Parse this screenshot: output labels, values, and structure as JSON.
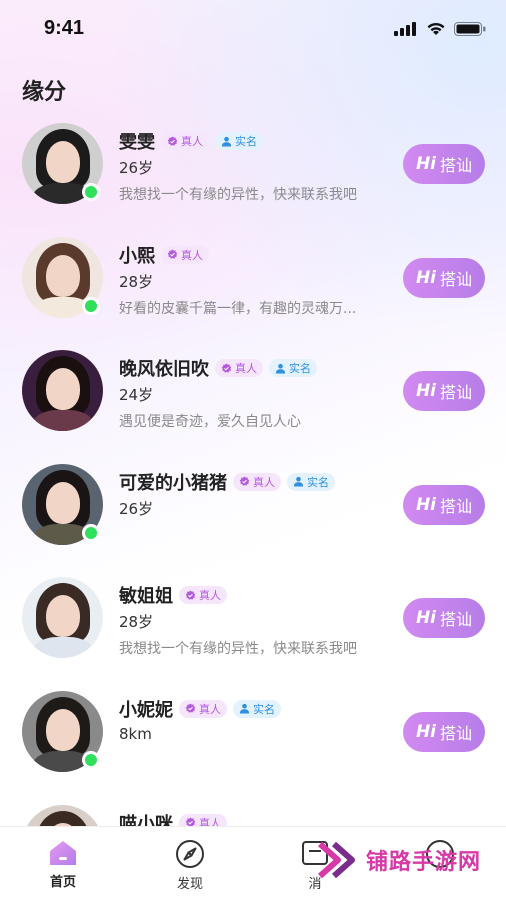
{
  "status_bar": {
    "time": "9:41"
  },
  "header": {
    "title": "缘分"
  },
  "tags": {
    "real": "真人",
    "verified": "实名"
  },
  "users": [
    {
      "name": "雯雯",
      "age": "26岁",
      "bio": "我想找一个有缘的异性，快来联系我吧",
      "real": true,
      "verified": true,
      "online": true,
      "palette": {
        "bg": "#cfcfcf",
        "hair": "#1b1b1b",
        "body": "#2a2a2a"
      }
    },
    {
      "name": "小熙",
      "age": "28岁",
      "bio": "好看的皮囊千篇一律，有趣的灵魂万...",
      "real": true,
      "verified": false,
      "online": true,
      "palette": {
        "bg": "#efe7df",
        "hair": "#5a3a2a",
        "body": "#f4e9dd"
      }
    },
    {
      "name": "晚风依旧吹",
      "age": "24岁",
      "bio": "遇见便是奇迹，爱久自见人心",
      "real": true,
      "verified": true,
      "online": false,
      "palette": {
        "bg": "#3a1e3e",
        "hair": "#1a1010",
        "body": "#6a3a4a"
      }
    },
    {
      "name": "可爱的小猪猪",
      "age": "26岁",
      "bio": "",
      "real": true,
      "verified": true,
      "online": true,
      "palette": {
        "bg": "#5a6470",
        "hair": "#1a1414",
        "body": "#5d5a4a"
      }
    },
    {
      "name": "敏姐姐",
      "age": "28岁",
      "bio": "我想找一个有缘的异性，快来联系我吧",
      "real": true,
      "verified": false,
      "online": false,
      "palette": {
        "bg": "#e9eef3",
        "hair": "#3a2a24",
        "body": "#dfe5ee"
      }
    },
    {
      "name": "小妮妮",
      "age": "8km",
      "bio": "",
      "real": true,
      "verified": true,
      "online": true,
      "palette": {
        "bg": "#8a8a8a",
        "hair": "#1e1a18",
        "body": "#4a4a4a"
      }
    },
    {
      "name": "喵小咪",
      "age": "",
      "bio": "",
      "real": true,
      "verified": false,
      "online": false,
      "palette": {
        "bg": "#d9cfc9",
        "hair": "#3a2a22",
        "body": "#c9b8ae"
      }
    }
  ],
  "actions": {
    "hi": "Hi",
    "chat_label": "搭讪"
  },
  "tabbar": {
    "items": [
      {
        "label": "首页",
        "icon": "home-icon",
        "active": true
      },
      {
        "label": "发现",
        "icon": "compass-icon",
        "active": false
      },
      {
        "label": "消",
        "icon": "message-icon",
        "active": false
      },
      {
        "label": "",
        "icon": "profile-icon",
        "active": false
      }
    ]
  },
  "watermark": {
    "text": "铺路手游网"
  },
  "colors": {
    "accent": "#c184ee",
    "online": "#2ee05a",
    "real_tag": "#b45ae0",
    "verified_tag": "#2f8fe0"
  }
}
